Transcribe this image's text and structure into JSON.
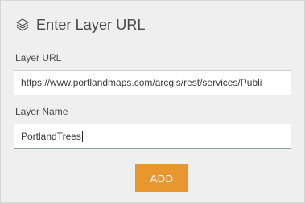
{
  "header": {
    "icon": "layers-icon",
    "title": "Enter Layer URL"
  },
  "form": {
    "url_label": "Layer URL",
    "url_value": "https://www.portlandmaps.com/arcgis/rest/services/Publi",
    "name_label": "Layer Name",
    "name_value": "PortlandTrees"
  },
  "actions": {
    "add_label": "ADD"
  },
  "colors": {
    "accent": "#e8962f",
    "panel_bg": "#efefef",
    "text": "#4a4a4a"
  }
}
